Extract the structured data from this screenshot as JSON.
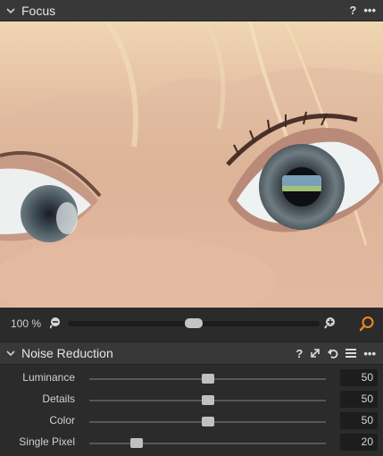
{
  "focus_panel": {
    "title": "Focus",
    "help_label": "?",
    "more_label": "•••"
  },
  "zoom": {
    "label": "100 %",
    "level": 0.5
  },
  "noise_panel": {
    "title": "Noise Reduction",
    "help_label": "?",
    "more_label": "•••",
    "sliders": [
      {
        "label": "Luminance",
        "value": "50",
        "fraction": 0.5
      },
      {
        "label": "Details",
        "value": "50",
        "fraction": 0.5
      },
      {
        "label": "Color",
        "value": "50",
        "fraction": 0.5
      },
      {
        "label": "Single Pixel",
        "value": "20",
        "fraction": 0.2
      }
    ]
  },
  "colors": {
    "accent": "#f08a1c",
    "panel_header": "#383838",
    "background": "#2b2b2b"
  }
}
